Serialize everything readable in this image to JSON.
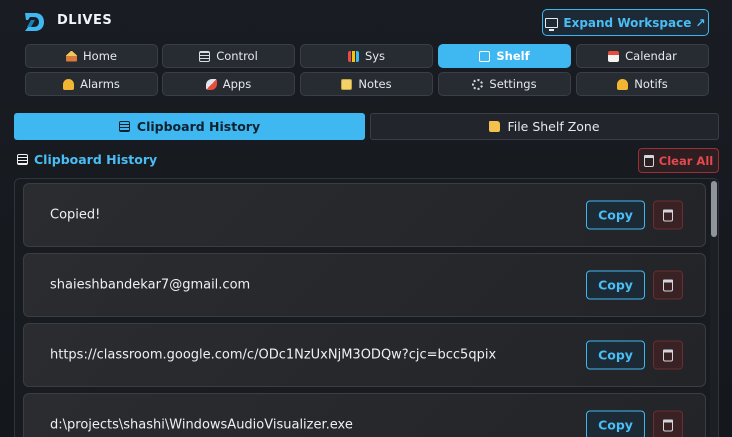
{
  "app": {
    "title": "DLIVES",
    "expand_label": "Expand Workspace ↗"
  },
  "nav": [
    {
      "label": "Home",
      "icon": "home-icon",
      "active": false
    },
    {
      "label": "Control",
      "icon": "control-panel-icon",
      "active": false
    },
    {
      "label": "Sys",
      "icon": "bar-chart-icon",
      "active": false
    },
    {
      "label": "Shelf",
      "icon": "clipboard-icon",
      "active": true
    },
    {
      "label": "Calendar",
      "icon": "calendar-icon",
      "active": false
    },
    {
      "label": "Alarms",
      "icon": "bell-icon",
      "active": false
    },
    {
      "label": "Apps",
      "icon": "rocket-icon",
      "active": false
    },
    {
      "label": "Notes",
      "icon": "notepad-icon",
      "active": false
    },
    {
      "label": "Settings",
      "icon": "gear-icon",
      "active": false
    },
    {
      "label": "Notifs",
      "icon": "bell-icon",
      "active": false
    }
  ],
  "tabs": {
    "clipboard": "Clipboard History",
    "files": "File Shelf Zone"
  },
  "section": {
    "title": "Clipboard History",
    "clear_label": "Clear All"
  },
  "items": [
    {
      "text": "Copied!",
      "copy_label": "Copy"
    },
    {
      "text": "shaieshbandekar7@gmail.com",
      "copy_label": "Copy"
    },
    {
      "text": "https://classroom.google.com/c/ODc1NzUxNjM3ODQw?cjc=bcc5qpix",
      "copy_label": "Copy"
    },
    {
      "text": "d:\\projects\\shashi\\WindowsAudioVisualizer.exe",
      "copy_label": "Copy"
    }
  ],
  "colors": {
    "accent": "#3fb8f2",
    "danger": "#e5484d",
    "background": "#15181d"
  }
}
